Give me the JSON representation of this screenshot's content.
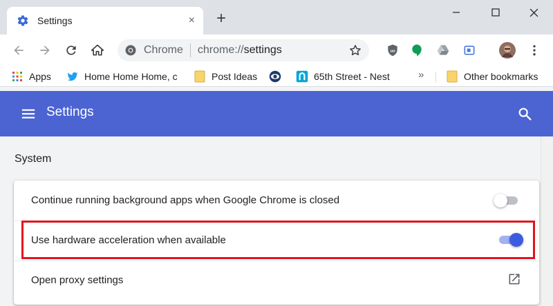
{
  "window": {
    "tab_title": "Settings",
    "tab_close": "×",
    "new_tab": "+"
  },
  "toolbar": {
    "site_name": "Chrome",
    "url_scheme": "chrome://",
    "url_path": "settings"
  },
  "bookmarks": {
    "items": [
      {
        "label": "Apps",
        "icon": "apps-grid-icon"
      },
      {
        "label": "Home Home Home, c",
        "icon": "twitter-bird-icon"
      },
      {
        "label": "Post Ideas",
        "icon": "folder-icon"
      },
      {
        "label": "",
        "icon": "eye-logo-icon"
      },
      {
        "label": "65th Street - Nest",
        "icon": "nest-logo-icon"
      }
    ],
    "more": "»",
    "other": "Other bookmarks"
  },
  "settings": {
    "header_title": "Settings",
    "section_title": "System",
    "rows": [
      {
        "label": "Continue running background apps when Google Chrome is closed",
        "control": "toggle",
        "enabled": false
      },
      {
        "label": "Use hardware acceleration when available",
        "control": "toggle",
        "enabled": true
      },
      {
        "label": "Open proxy settings",
        "control": "external-link"
      }
    ]
  },
  "colors": {
    "header_bg": "#4c63d2",
    "toggle_on": "#3b5ce0",
    "highlight": "#e2131b"
  }
}
